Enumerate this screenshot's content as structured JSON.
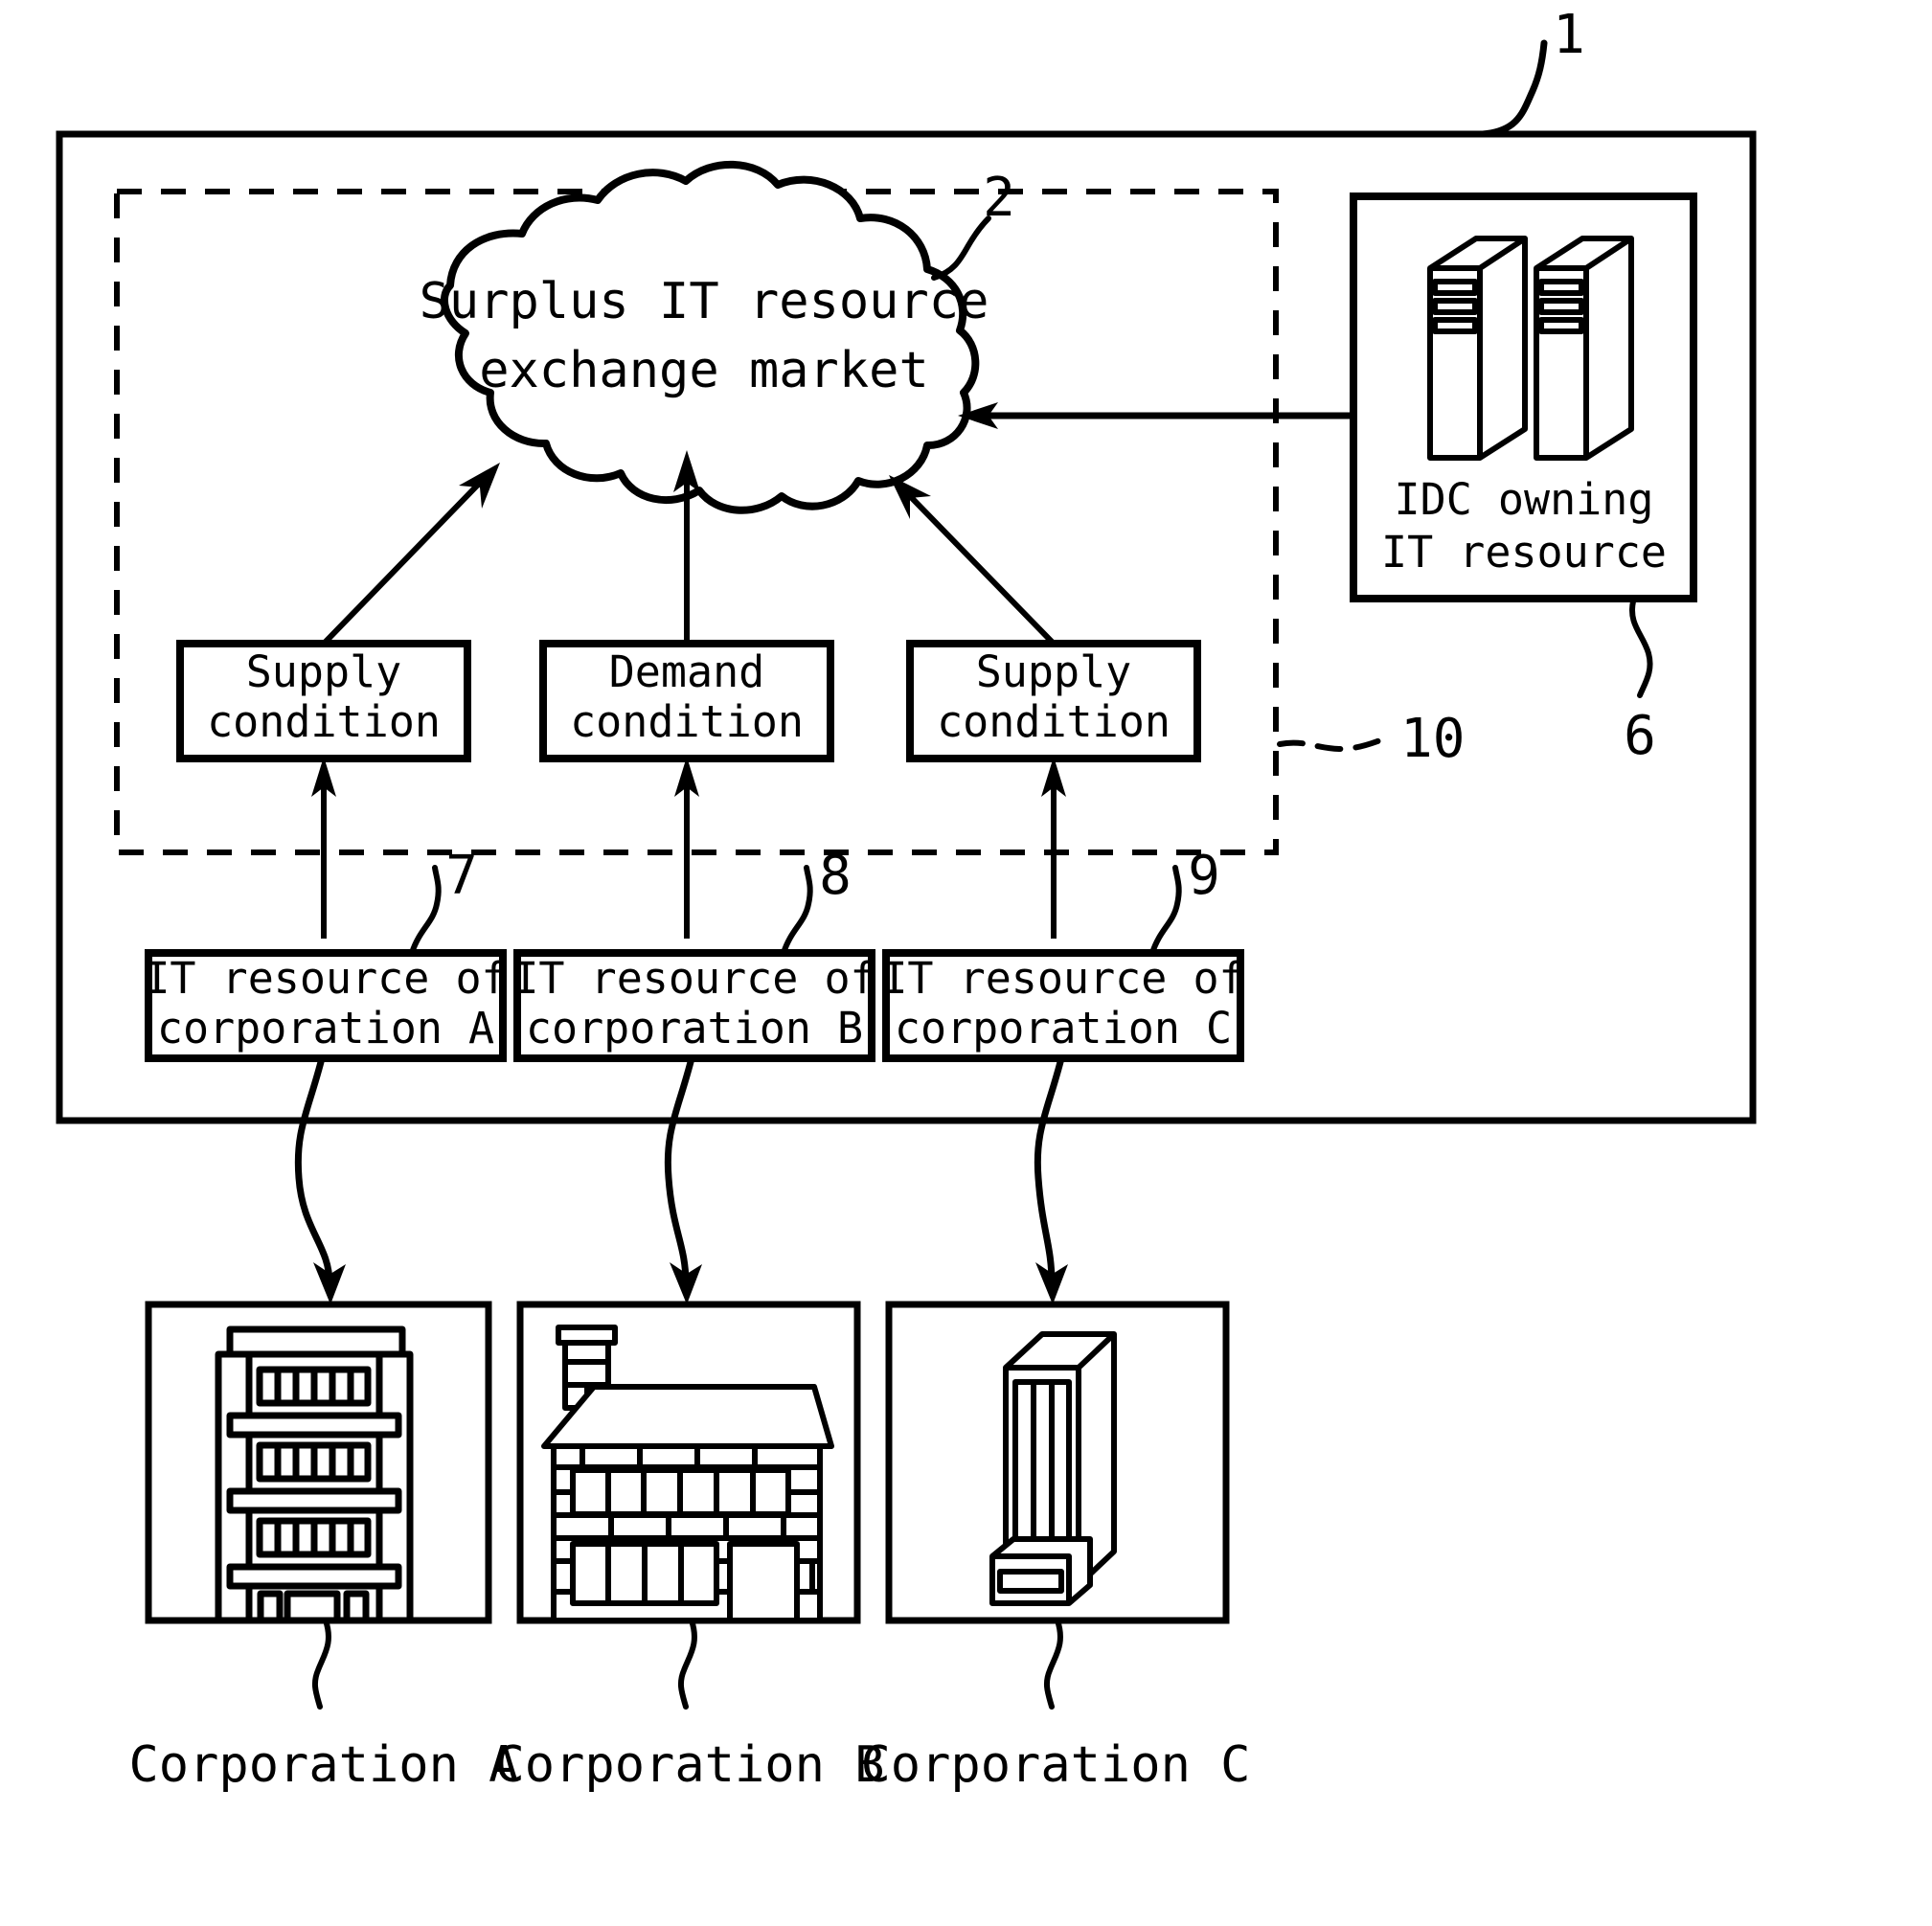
{
  "figure": {
    "kind": "patent-diagram",
    "stroke_color": "#000000",
    "background_color": "#ffffff"
  },
  "reference_numerals": {
    "system": "1",
    "market": "2",
    "idc": "6",
    "resource_a": "7",
    "resource_b": "8",
    "resource_c": "9",
    "exchange_region": "10"
  },
  "cloud": {
    "line1": "Surplus IT resource",
    "line2": "exchange market"
  },
  "idc_box": {
    "line1": "IDC owning",
    "line2": "IT resource",
    "icon": "server-racks-icon"
  },
  "condition_boxes": [
    {
      "line1": "Supply",
      "line2": "condition"
    },
    {
      "line1": "Demand",
      "line2": "condition"
    },
    {
      "line1": "Supply",
      "line2": "condition"
    }
  ],
  "resource_boxes": [
    {
      "line1": "IT resource of",
      "line2": "corporation A"
    },
    {
      "line1": "IT resource of",
      "line2": "corporation B"
    },
    {
      "line1": "IT resource of",
      "line2": "corporation C"
    }
  ],
  "corporations": [
    {
      "label": "Corporation A",
      "icon": "office-building-icon"
    },
    {
      "label": "Corporation B",
      "icon": "brick-house-icon"
    },
    {
      "label": "Corporation C",
      "icon": "server-tower-icon"
    }
  ]
}
